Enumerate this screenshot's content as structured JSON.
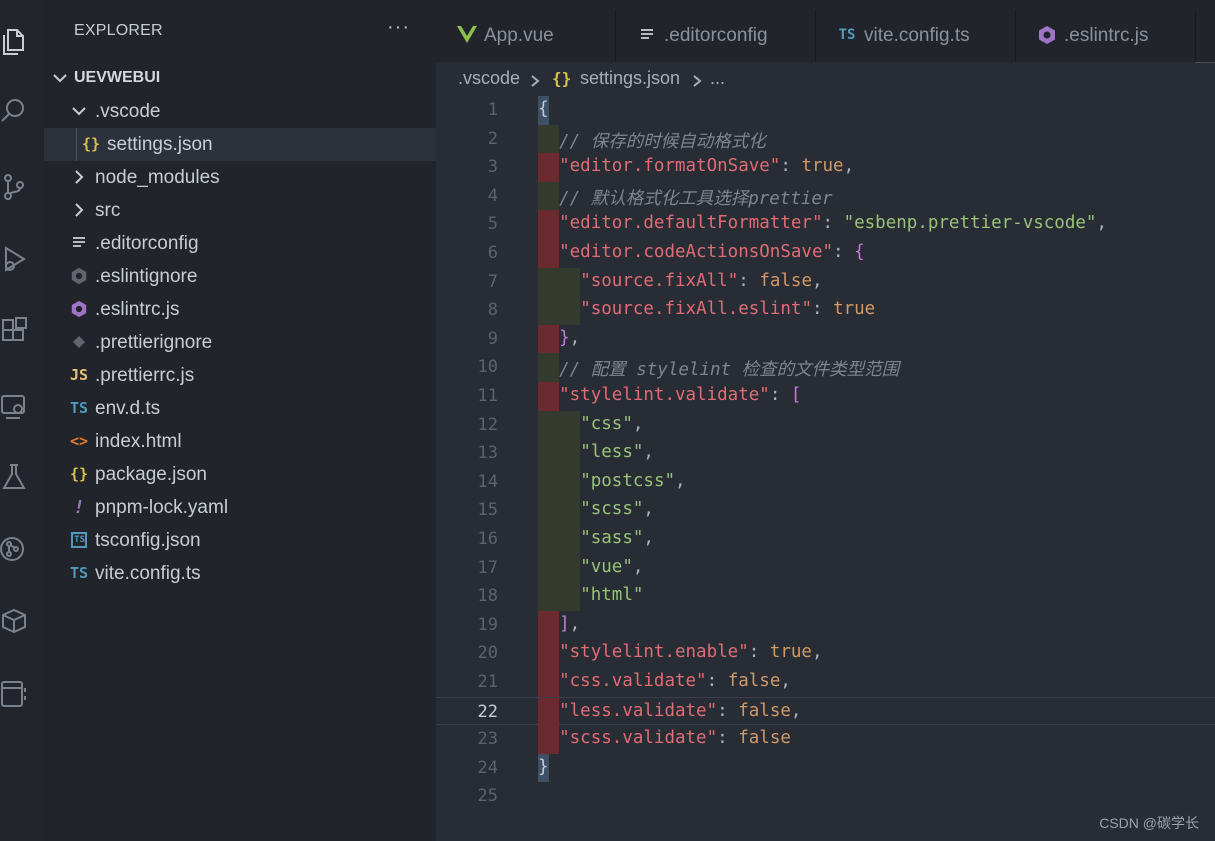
{
  "activity_bar": {
    "icons": [
      "explorer-icon",
      "search-icon",
      "source-control-icon",
      "run-debug-icon",
      "extensions-icon",
      "remote-explorer-icon",
      "testing-icon",
      "git-graph-icon",
      "package-icon",
      "panel-icon"
    ]
  },
  "sidebar": {
    "title": "EXPLORER",
    "more_actions": "···",
    "root_folder": "UEVWEBUI",
    "items": [
      {
        "label": ".vscode",
        "icon": "chevron-down-icon",
        "indent": 1,
        "expanded": true
      },
      {
        "label": "settings.json",
        "icon": "{}",
        "indent": 2,
        "selected": true,
        "icon_color": "#d6c44a"
      },
      {
        "label": "node_modules",
        "icon": "chevron-right-icon",
        "indent": 1
      },
      {
        "label": "src",
        "icon": "chevron-right-icon",
        "indent": 1
      },
      {
        "label": ".editorconfig",
        "icon": "lines-icon",
        "indent": 1,
        "icon_color": "#b7bdc6"
      },
      {
        "label": ".eslintignore",
        "icon": "eslint-icon",
        "indent": 1,
        "icon_color": "#5f6670"
      },
      {
        "label": ".eslintrc.js",
        "icon": "eslint-icon",
        "indent": 1,
        "icon_color": "#a074c4"
      },
      {
        "label": ".prettierignore",
        "icon": "prettier-icon",
        "indent": 1,
        "icon_color": "#5f6670"
      },
      {
        "label": ".prettierrc.js",
        "icon": "JS",
        "indent": 1,
        "icon_color": "#e5c07b"
      },
      {
        "label": "env.d.ts",
        "icon": "TS",
        "indent": 1,
        "icon_color": "#519aba"
      },
      {
        "label": "index.html",
        "icon": "<>",
        "indent": 1,
        "icon_color": "#e37933"
      },
      {
        "label": "package.json",
        "icon": "{}",
        "indent": 1,
        "icon_color": "#d6c44a"
      },
      {
        "label": "pnpm-lock.yaml",
        "icon": "!",
        "indent": 1,
        "icon_color": "#a074c4"
      },
      {
        "label": "tsconfig.json",
        "icon": "ts",
        "indent": 1,
        "icon_color": "#519aba"
      },
      {
        "label": "vite.config.ts",
        "icon": "TS",
        "indent": 1,
        "icon_color": "#519aba"
      }
    ]
  },
  "tabs": [
    {
      "label": "App.vue",
      "icon": "vue-icon",
      "icon_color": "#8dc149"
    },
    {
      "label": ".editorconfig",
      "icon": "lines-icon",
      "icon_color": "#b7bdc6"
    },
    {
      "label": "vite.config.ts",
      "icon": "TS",
      "icon_color": "#519aba"
    },
    {
      "label": ".eslintrc.js",
      "icon": "eslint-icon",
      "icon_color": "#a074c4"
    }
  ],
  "breadcrumb": {
    "folder": ".vscode",
    "file_icon": "{}",
    "file": "settings.json",
    "more": "..."
  },
  "editor": {
    "current_line": 22,
    "lines": [
      {
        "n": 1,
        "tokens": [
          [
            "t-brace",
            "{"
          ]
        ]
      },
      {
        "n": 2,
        "tokens": [
          [
            "t-comment",
            "// 保存的时候自动格式化"
          ]
        ]
      },
      {
        "n": 3,
        "tokens": [
          [
            "t-key",
            "\"editor.formatOnSave\""
          ],
          [
            "t-punc",
            ": "
          ],
          [
            "t-bool",
            "true"
          ],
          [
            "t-punc",
            ","
          ]
        ]
      },
      {
        "n": 4,
        "tokens": [
          [
            "t-comment",
            "// 默认格式化工具选择prettier"
          ]
        ]
      },
      {
        "n": 5,
        "tokens": [
          [
            "t-key",
            "\"editor.defaultFormatter\""
          ],
          [
            "t-punc",
            ": "
          ],
          [
            "t-str",
            "\"esbenp.prettier-vscode\""
          ],
          [
            "t-punc",
            ","
          ]
        ]
      },
      {
        "n": 6,
        "tokens": [
          [
            "t-key",
            "\"editor.codeActionsOnSave\""
          ],
          [
            "t-punc",
            ": "
          ],
          [
            "t-bracket-p",
            "{"
          ]
        ]
      },
      {
        "n": 7,
        "tokens": [
          [
            "t-key",
            "\"source.fixAll\""
          ],
          [
            "t-punc",
            ": "
          ],
          [
            "t-bool",
            "false"
          ],
          [
            "t-punc",
            ","
          ]
        ]
      },
      {
        "n": 8,
        "tokens": [
          [
            "t-key",
            "\"source.fixAll.eslint\""
          ],
          [
            "t-punc",
            ": "
          ],
          [
            "t-bool",
            "true"
          ]
        ]
      },
      {
        "n": 9,
        "tokens": [
          [
            "t-bracket-p",
            "}"
          ],
          [
            "t-punc",
            ","
          ]
        ]
      },
      {
        "n": 10,
        "tokens": [
          [
            "t-comment",
            "// 配置 stylelint 检查的文件类型范围"
          ]
        ]
      },
      {
        "n": 11,
        "tokens": [
          [
            "t-key",
            "\"stylelint.validate\""
          ],
          [
            "t-punc",
            ": "
          ],
          [
            "t-bracket-p",
            "["
          ]
        ]
      },
      {
        "n": 12,
        "tokens": [
          [
            "t-str",
            "\"css\""
          ],
          [
            "t-punc",
            ","
          ]
        ]
      },
      {
        "n": 13,
        "tokens": [
          [
            "t-str",
            "\"less\""
          ],
          [
            "t-punc",
            ","
          ]
        ]
      },
      {
        "n": 14,
        "tokens": [
          [
            "t-str",
            "\"postcss\""
          ],
          [
            "t-punc",
            ","
          ]
        ]
      },
      {
        "n": 15,
        "tokens": [
          [
            "t-str",
            "\"scss\""
          ],
          [
            "t-punc",
            ","
          ]
        ]
      },
      {
        "n": 16,
        "tokens": [
          [
            "t-str",
            "\"sass\""
          ],
          [
            "t-punc",
            ","
          ]
        ]
      },
      {
        "n": 17,
        "tokens": [
          [
            "t-str",
            "\"vue\""
          ],
          [
            "t-punc",
            ","
          ]
        ]
      },
      {
        "n": 18,
        "tokens": [
          [
            "t-str",
            "\"html\""
          ]
        ]
      },
      {
        "n": 19,
        "tokens": [
          [
            "t-bracket-p",
            "]"
          ],
          [
            "t-punc",
            ","
          ]
        ]
      },
      {
        "n": 20,
        "tokens": [
          [
            "t-key",
            "\"stylelint.enable\""
          ],
          [
            "t-punc",
            ": "
          ],
          [
            "t-bool",
            "true"
          ],
          [
            "t-punc",
            ","
          ]
        ]
      },
      {
        "n": 21,
        "tokens": [
          [
            "t-key",
            "\"css.validate\""
          ],
          [
            "t-punc",
            ": "
          ],
          [
            "t-bool",
            "false"
          ],
          [
            "t-punc",
            ","
          ]
        ]
      },
      {
        "n": 22,
        "tokens": [
          [
            "t-key",
            "\"less.validate\""
          ],
          [
            "t-punc",
            ": "
          ],
          [
            "t-bool",
            "false"
          ],
          [
            "t-punc",
            ","
          ]
        ]
      },
      {
        "n": 23,
        "tokens": [
          [
            "t-key",
            "\"scss.validate\""
          ],
          [
            "t-punc",
            ": "
          ],
          [
            "t-bool",
            "false"
          ]
        ]
      },
      {
        "n": 24,
        "tokens": [
          [
            "t-brace",
            "}"
          ]
        ]
      },
      {
        "n": 25,
        "tokens": []
      }
    ]
  },
  "watermark": "CSDN @碳学长",
  "colors": {
    "background": "#282c34",
    "sidebar": "#21252b",
    "selection": "#2c313c",
    "error_indent": "#6b2a30",
    "indent_level2": "#343a2d",
    "brace_highlight": "#3d5066"
  }
}
